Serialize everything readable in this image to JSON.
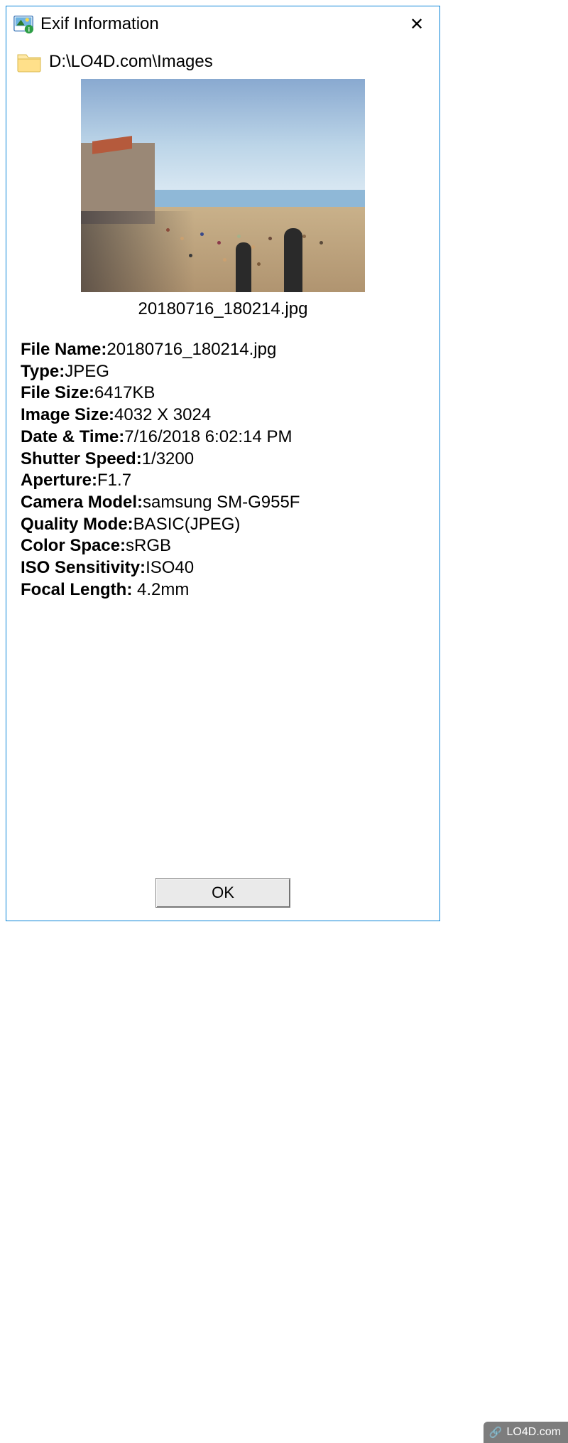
{
  "window": {
    "title": "Exif Information",
    "close_glyph": "✕"
  },
  "path": "D:\\LO4D.com\\Images",
  "thumbnail_caption": "20180716_180214.jpg",
  "exif": {
    "rows": [
      {
        "label": "File Name:",
        "value": "20180716_180214.jpg"
      },
      {
        "label": "Type:",
        "value": "JPEG"
      },
      {
        "label": "File Size:",
        "value": "6417KB"
      },
      {
        "label": "Image Size:",
        "value": "4032 X 3024"
      },
      {
        "label": "Date & Time:",
        "value": "7/16/2018 6:02:14 PM"
      },
      {
        "label": "Shutter Speed:",
        "value": "1/3200"
      },
      {
        "label": "Aperture:",
        "value": "F1.7"
      },
      {
        "label": "Camera Model:",
        "value": "samsung SM-G955F"
      },
      {
        "label": "Quality Mode:",
        "value": "BASIC(JPEG)"
      },
      {
        "label": "Color Space:",
        "value": "sRGB"
      },
      {
        "label": "ISO Sensitivity:",
        "value": "ISO40"
      },
      {
        "label": "Focal Length:",
        "value": " 4.2mm"
      }
    ]
  },
  "buttons": {
    "ok": "OK"
  },
  "watermark": "LO4D.com"
}
